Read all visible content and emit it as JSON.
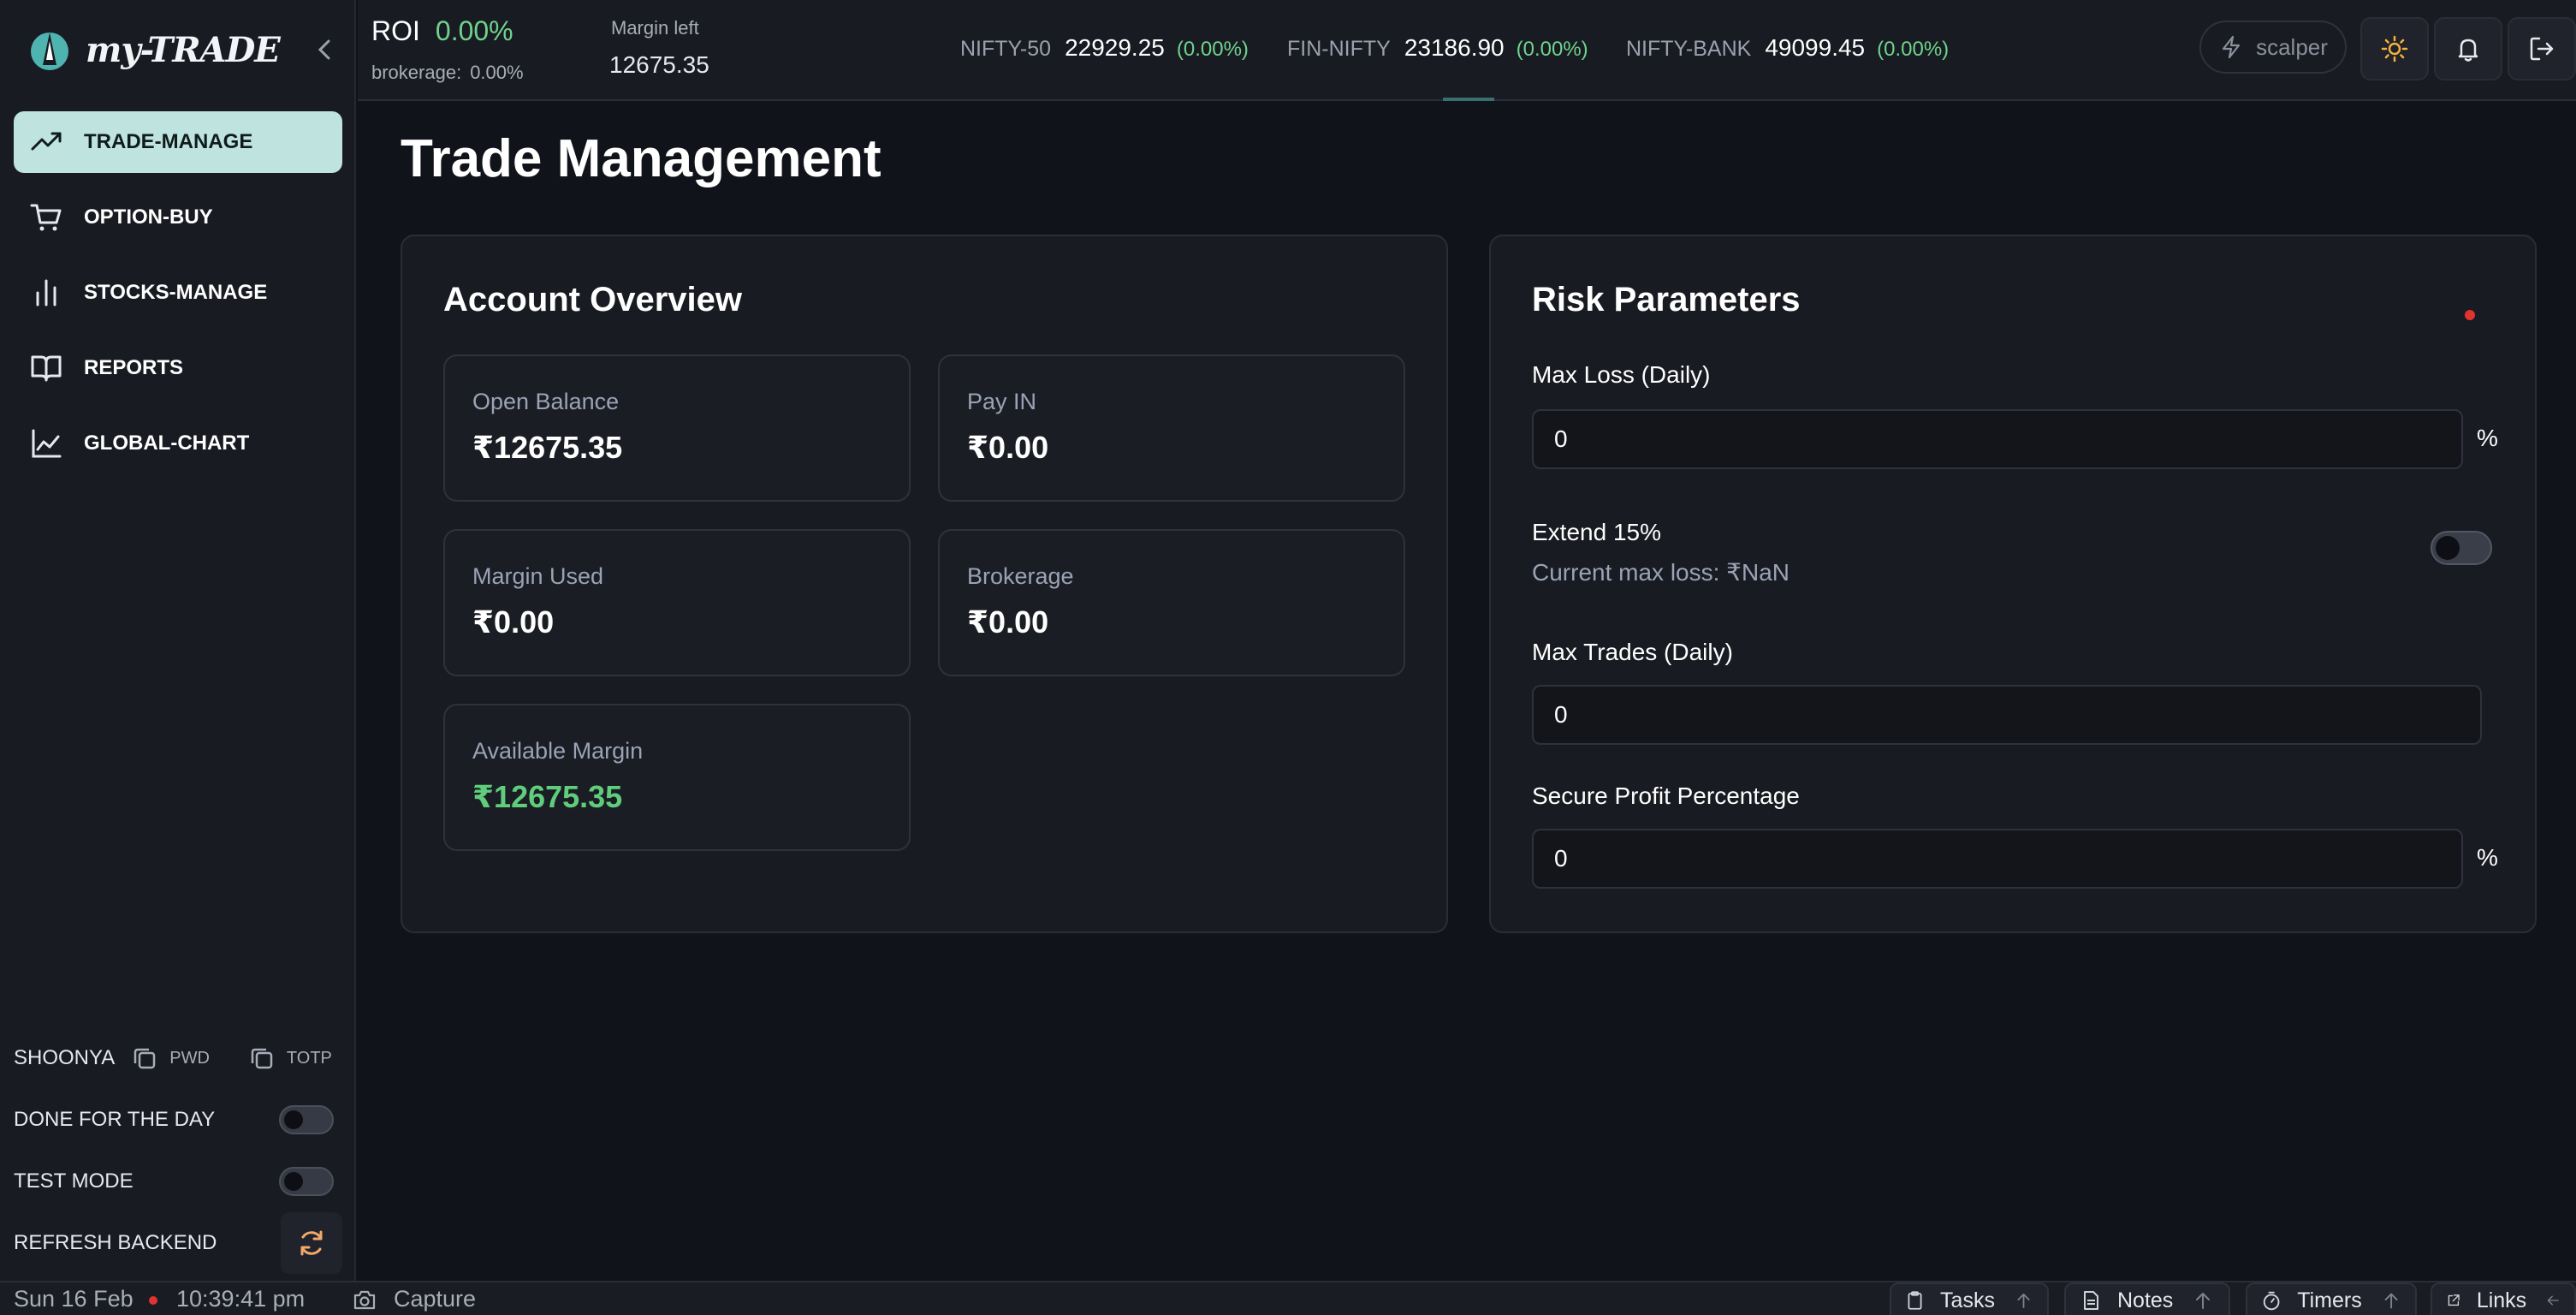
{
  "app": {
    "name": "my-TRADE"
  },
  "sidebar": {
    "items": [
      {
        "label": "TRADE-MANAGE",
        "icon": "trending-up-icon",
        "active": true
      },
      {
        "label": "OPTION-BUY",
        "icon": "cart-icon",
        "active": false
      },
      {
        "label": "STOCKS-MANAGE",
        "icon": "bar-chart-icon",
        "active": false
      },
      {
        "label": "REPORTS",
        "icon": "book-icon",
        "active": false
      },
      {
        "label": "GLOBAL-CHART",
        "icon": "line-chart-icon",
        "active": false
      }
    ],
    "broker": {
      "label": "SHOONYA",
      "pwd": "PWD",
      "totp": "TOTP"
    },
    "done_for_day": {
      "label": "DONE FOR THE DAY",
      "on": false
    },
    "test_mode": {
      "label": "TEST MODE",
      "on": false
    },
    "refresh": {
      "label": "REFRESH BACKEND"
    }
  },
  "topbar": {
    "roi_label": "ROI",
    "roi_value": "0.00%",
    "brokerage_label": "brokerage:",
    "brokerage_value": "0.00%",
    "margin_left_label": "Margin left",
    "margin_left_value": "12675.35",
    "indices": [
      {
        "name": "NIFTY-50",
        "price": "22929.25",
        "change": "(0.00%)"
      },
      {
        "name": "FIN-NIFTY",
        "price": "23186.90",
        "change": "(0.00%)"
      },
      {
        "name": "NIFTY-BANK",
        "price": "49099.45",
        "change": "(0.00%)"
      }
    ],
    "mode_label": "scalper"
  },
  "main": {
    "title": "Trade Management",
    "account": {
      "title": "Account Overview",
      "open_balance": {
        "label": "Open Balance",
        "value": "₹12675.35"
      },
      "pay_in": {
        "label": "Pay IN",
        "value": "₹0.00"
      },
      "margin_used": {
        "label": "Margin Used",
        "value": "₹0.00"
      },
      "brokerage": {
        "label": "Brokerage",
        "value": "₹0.00"
      },
      "available_margin": {
        "label": "Available Margin",
        "value": "₹12675.35"
      }
    },
    "risk": {
      "title": "Risk Parameters",
      "max_loss": {
        "label": "Max Loss (Daily)",
        "value": "0",
        "unit": "%"
      },
      "extend": {
        "label": "Extend 15%",
        "sub": "Current max loss: ₹NaN",
        "on": false
      },
      "max_trades": {
        "label": "Max Trades (Daily)",
        "value": "0"
      },
      "secure_profit": {
        "label": "Secure Profit Percentage",
        "value": "0",
        "unit": "%"
      }
    }
  },
  "statusbar": {
    "date": "Sun 16 Feb",
    "time": "10:39:41 pm",
    "capture": "Capture",
    "tabs": [
      "Tasks",
      "Notes",
      "Timers",
      "Links"
    ]
  },
  "colors": {
    "accent": "#bfe3de",
    "positive": "#5fcd7b",
    "alert": "#e0342f",
    "background": "#11131a"
  }
}
